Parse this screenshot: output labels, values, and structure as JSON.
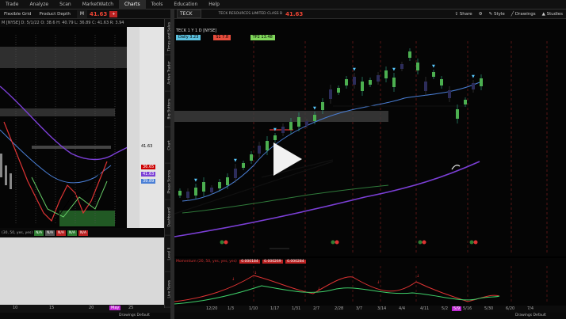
{
  "top_menu": [
    "Trade",
    "Analyze",
    "Scan",
    "MarketWatch",
    "Charts",
    "Tools",
    "Education",
    "Help"
  ],
  "top_menu_active": "Charts",
  "left_panel": {
    "toolbar": [
      "Flexible Grid",
      "Product Depth"
    ],
    "symbol": "M",
    "price": "41.63",
    "badge": "+",
    "header": "M [NYSE]  D: 5/1/22  O: 38.6  H: 40.79  L: 36.89  C: 41.63  R: 3.94",
    "right_prices": [
      "41.63",
      "36.65",
      "41.63",
      "39.89"
    ],
    "sub_label": "(30, 50, yes, yes)",
    "sub_chips": [
      "N/A",
      "N/A",
      "N/A",
      "N/A",
      "N/A"
    ],
    "axis_labels": [
      "10",
      "15",
      "20",
      "25"
    ],
    "axis_highlight": "May",
    "bottom": "Drawings  Default"
  },
  "side_tabs": [
    "Times and Sales",
    "Active Trader",
    "Big Buttons",
    "Chart",
    "Phase Scores",
    "Dashboard",
    "Level II",
    "Live News"
  ],
  "right_panel": {
    "symbol": "TECK",
    "company": "TECK RESOURCES LIMITED CLASS B",
    "price": "41.63",
    "tools": [
      "Share",
      "Style",
      "Drawings",
      "Studies"
    ],
    "header": "TECK 1 Y 1 D [NYSE]",
    "chips": [
      {
        "label": "Daily  3.23",
        "color": "#5bc0de"
      },
      {
        "label": "S1  7.8",
        "color": "#e74c3c"
      },
      {
        "label": "",
        "color": "#c8e64a"
      },
      {
        "label": "TP2  13.48",
        "color": "#7fd65a"
      }
    ],
    "sub_header": "Momentum (20, 50, yes, yes, yes)",
    "sub_chips": [
      "0.000184",
      "0.000269",
      "0.000284"
    ],
    "x_labels": [
      "12/20",
      "1/3",
      "1/10",
      "1/17",
      "1/31",
      "2/7",
      "2/28",
      "3/7",
      "3/14",
      "4/4",
      "4/11",
      "5/2",
      "5/16",
      "5/30",
      "6/20",
      "7/4"
    ],
    "x_highlight": "5/9",
    "bottom": "Drawings  Default"
  },
  "colors": {
    "accent": "#e43b2c",
    "ma_purple": "#7b3fd6",
    "ma_blue": "#4a7fd6",
    "grid_red": "#8b1e1e",
    "candle_green": "#4caf50",
    "candle_dark": "#3b2a6b",
    "momentum_green": "#3fd16a",
    "momentum_red": "#d33030"
  },
  "play_icon": "play-icon"
}
